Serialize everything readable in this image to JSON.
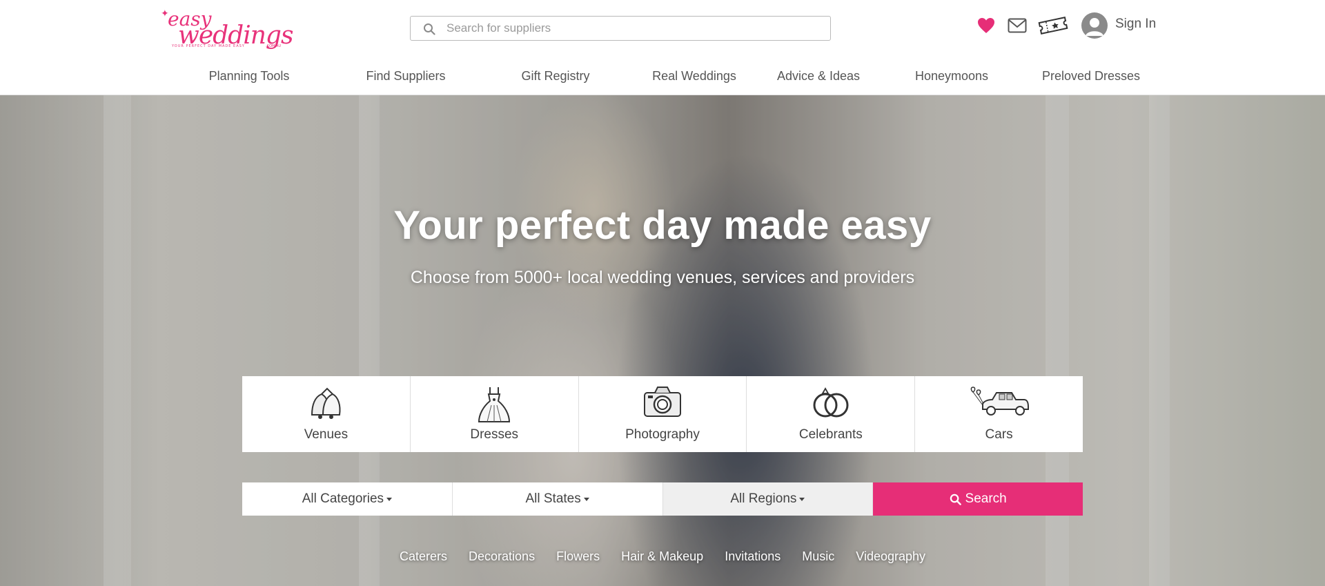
{
  "brand": {
    "logo_word1": "easy",
    "logo_word2": "weddings",
    "logo_tagline": "YOUR PERFECT DAY MADE EASY",
    "logo_domain": ".COM.AU",
    "accent_color": "#e62e77"
  },
  "header": {
    "search_placeholder": "Search for suppliers",
    "icons": [
      "heart-icon",
      "mail-icon",
      "ticket-icon",
      "avatar-icon"
    ],
    "signin_label": "Sign In"
  },
  "nav": {
    "items": [
      {
        "label": "Planning Tools"
      },
      {
        "label": "Find Suppliers"
      },
      {
        "label": "Gift Registry"
      },
      {
        "label": "Real Weddings"
      },
      {
        "label": "Advice & Ideas"
      },
      {
        "label": "Honeymoons"
      },
      {
        "label": "Preloved Dresses"
      }
    ]
  },
  "hero": {
    "title": "Your perfect day made easy",
    "subtitle": "Choose from 5000+ local wedding venues, services and providers"
  },
  "categories": [
    {
      "label": "Venues",
      "icon": "bells-icon"
    },
    {
      "label": "Dresses",
      "icon": "dress-icon"
    },
    {
      "label": "Photography",
      "icon": "camera-icon"
    },
    {
      "label": "Celebrants",
      "icon": "rings-icon"
    },
    {
      "label": "Cars",
      "icon": "car-icon"
    }
  ],
  "filters": {
    "category": "All Categories",
    "state": "All States",
    "region": "All Regions",
    "search_label": "Search"
  },
  "quick_links": [
    "Caterers",
    "Decorations",
    "Flowers",
    "Hair & Makeup",
    "Invitations",
    "Music",
    "Videography"
  ]
}
